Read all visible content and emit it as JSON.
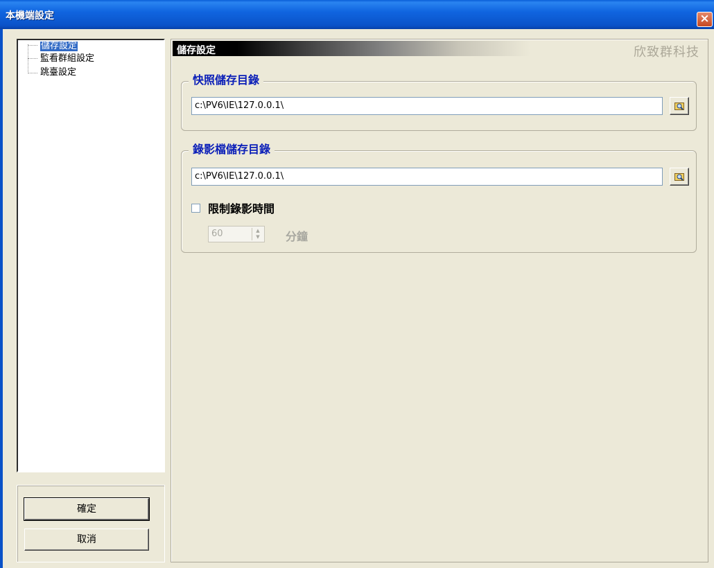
{
  "window": {
    "title": "本機端設定",
    "close_label": "×"
  },
  "tree": {
    "items": [
      {
        "label": "儲存設定",
        "selected": true
      },
      {
        "label": "監看群組設定",
        "selected": false
      },
      {
        "label": "跳臺設定",
        "selected": false
      }
    ]
  },
  "buttons": {
    "ok": "確定",
    "cancel": "取消"
  },
  "panel": {
    "header": "儲存設定",
    "brand": "欣致群科技"
  },
  "snapshot": {
    "legend": "快照儲存目錄",
    "path": "c:\\PV6\\IE\\127.0.0.1\\"
  },
  "recording": {
    "legend": "錄影檔儲存目錄",
    "path": "c:\\PV6\\IE\\127.0.0.1\\",
    "limit_label": "限制錄影時間",
    "limit_checked": false,
    "minutes": "60",
    "unit": "分鐘"
  },
  "colors": {
    "titlebar": "#0a52c8",
    "legend_text": "#0a1eb8",
    "window_bg": "#ece9d8"
  }
}
